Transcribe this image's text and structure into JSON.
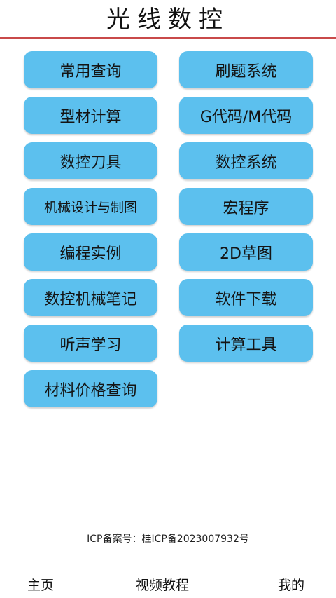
{
  "header": {
    "title": "光线数控"
  },
  "menu": {
    "left": [
      "常用查询",
      "型材计算",
      "数控刀具",
      "机械设计与制图",
      "编程实例",
      "数控机械笔记",
      "听声学习",
      "材料价格查询"
    ],
    "right": [
      "刷题系统",
      "G代码/M代码",
      "数控系统",
      "宏程序",
      "2D草图",
      "软件下载",
      "计算工具"
    ]
  },
  "footer": {
    "icp": "ICP备案号：桂ICP备2023007932号"
  },
  "nav": {
    "home": "主页",
    "video": "视频教程",
    "mine": "我的"
  },
  "colors": {
    "tile": "#5cc0ee",
    "title_rule": "#c94a4a"
  }
}
